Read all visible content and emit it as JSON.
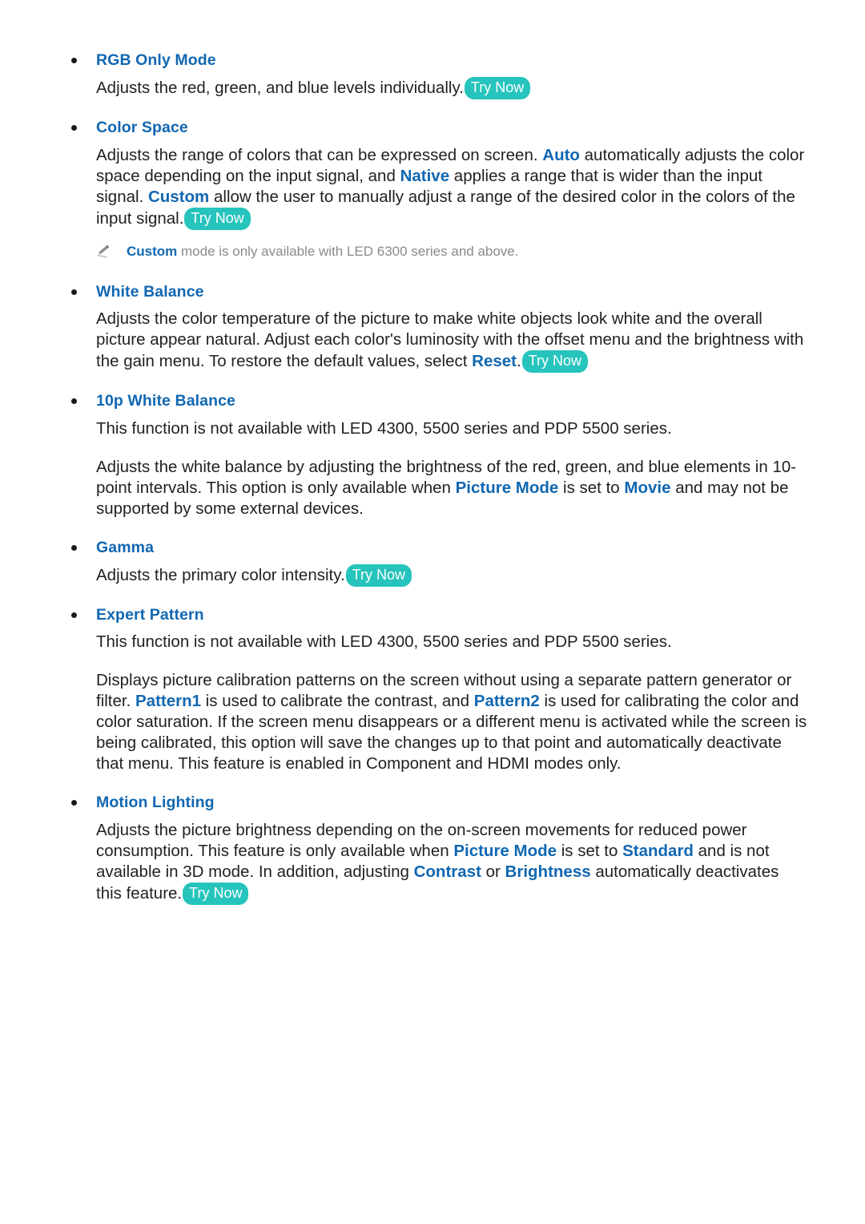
{
  "document": {
    "background_color": "#ffffff",
    "heading_color": "#1167b1",
    "body_color": "#231f20",
    "note_color": "#8a8a8a",
    "badge_color": "#26c4bc",
    "badge_text_color": "#ffffff"
  },
  "sections": [
    {
      "id": "rgb-only-mode",
      "heading": "RGB Only Mode",
      "body_pre": "Adjusts the red, green, and blue levels individually.",
      "badge": "Try Now"
    },
    {
      "id": "color-space",
      "heading": "Color Space",
      "body": {
        "p1": "Adjusts the range of colors that can be expressed on screen.",
        "term1": "Auto",
        "p2": "automatically adjusts the color space depending on the input signal, and",
        "term2": "Native",
        "p3": "applies a range that is wider than the input signal.",
        "term3": "Custom",
        "p4": "allow the user to manually adjust a range of the desired color in the colors of the input signal."
      },
      "badge": "Try Now",
      "note": {
        "icon": "pencil-icon",
        "term": "Custom",
        "text": "mode is only available with LED 6300 series and above."
      }
    },
    {
      "id": "white-balance",
      "heading": "White Balance",
      "body": {
        "p1": "Adjusts the color temperature of the picture to make white objects look white and the overall picture appear natural. Adjust each color's luminosity with the offset menu and the brightness with the gain menu. To restore the default values, select",
        "term1": "Reset",
        "p2": "."
      },
      "badge": "Try Now"
    },
    {
      "id": "10p-white-balance",
      "heading": "10p White Balance",
      "body_note": "This function is not available with LED 4300, 5500 series and PDP 5500 series.",
      "body": {
        "p1": "Adjusts the white balance by adjusting the brightness of the red, green, and blue elements in 10-point intervals. This option is only available when",
        "term1": "Picture Mode",
        "p2": "is set to",
        "term2": "Movie",
        "p3": "and may not be supported by some external devices."
      }
    },
    {
      "id": "gamma",
      "heading": "Gamma",
      "body_pre": "Adjusts the primary color intensity.",
      "badge": "Try Now"
    },
    {
      "id": "expert-pattern",
      "heading": "Expert Pattern",
      "body_note": "This function is not available with LED 4300, 5500 series and PDP 5500 series.",
      "body": {
        "p1": "Displays picture calibration patterns on the screen without using a separate pattern generator or filter.",
        "term1": "Pattern1",
        "p2": "is used to calibrate the contrast, and",
        "term2": "Pattern2",
        "p3": "is used for calibrating the color and color saturation. If the screen menu disappears or a different menu is activated while the screen is being calibrated, this option will save the changes up to that point and automatically deactivate that menu. This feature is enabled in Component and HDMI modes only."
      }
    },
    {
      "id": "motion-lighting",
      "heading": "Motion Lighting",
      "body": {
        "p1": "Adjusts the picture brightness depending on the on-screen movements for reduced power consumption. This feature is only available when",
        "term1": "Picture Mode",
        "p2": "is set to",
        "term2": "Standard",
        "p3": "and is not available in 3D mode. In addition, adjusting",
        "term3": "Contrast",
        "p4": "or",
        "term4": "Brightness",
        "p5": "automatically deactivates this feature."
      },
      "badge": "Try Now"
    }
  ]
}
